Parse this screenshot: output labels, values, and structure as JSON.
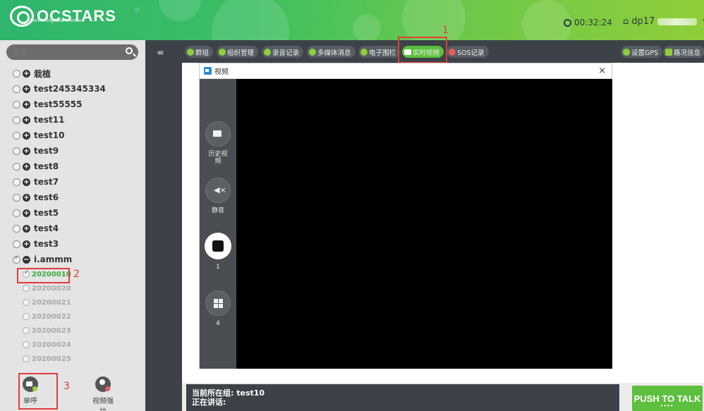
{
  "header": {
    "logo_text": "OCSTARS",
    "logo_sub": "Connecting New Frontiers",
    "clock": "00:32:24",
    "user": "dp17"
  },
  "annotations": {
    "n1": "1",
    "n2": "2",
    "n3": "3"
  },
  "sidebar": {
    "search_placeholder": "搜索",
    "groups": [
      {
        "label": "栽植"
      },
      {
        "label": "test245345334"
      },
      {
        "label": "test55555"
      },
      {
        "label": "test11"
      },
      {
        "label": "test10"
      },
      {
        "label": "test9"
      },
      {
        "label": "test8"
      },
      {
        "label": "test7"
      },
      {
        "label": "test6"
      },
      {
        "label": "test5"
      },
      {
        "label": "test4"
      },
      {
        "label": "test3"
      },
      {
        "label": "i.ammm"
      }
    ],
    "members": [
      {
        "label": "20200010"
      },
      {
        "label": "20200020"
      },
      {
        "label": "20200021"
      },
      {
        "label": "20200022"
      },
      {
        "label": "20200023"
      },
      {
        "label": "20200024"
      },
      {
        "label": "20200025"
      }
    ],
    "call_label": "单呼",
    "pull_label": "视频强拉"
  },
  "toolbar": {
    "items": [
      {
        "label": "群组"
      },
      {
        "label": "组织管理"
      },
      {
        "label": "录音记录"
      },
      {
        "label": "多媒体消息"
      },
      {
        "label": "电子围栏"
      },
      {
        "label": "实时视频"
      },
      {
        "label": "SOS记录"
      },
      {
        "label": "设置GPS"
      },
      {
        "label": "路况信息"
      }
    ]
  },
  "video_window": {
    "title": "视频",
    "close": "×",
    "history_label": "历史视频",
    "mute_label": "静音",
    "stop_count": "1",
    "grid_count": "4"
  },
  "status": {
    "group_label": "当前所在组:",
    "group_value": "test10",
    "speaking_label": "正在讲话:"
  },
  "ptt": {
    "label": "PUSH TO TALK",
    "dots": "••••"
  },
  "colors": {
    "accent": "#5bbf3c",
    "dark": "#3c4248",
    "annotation": "#e23c3c"
  }
}
